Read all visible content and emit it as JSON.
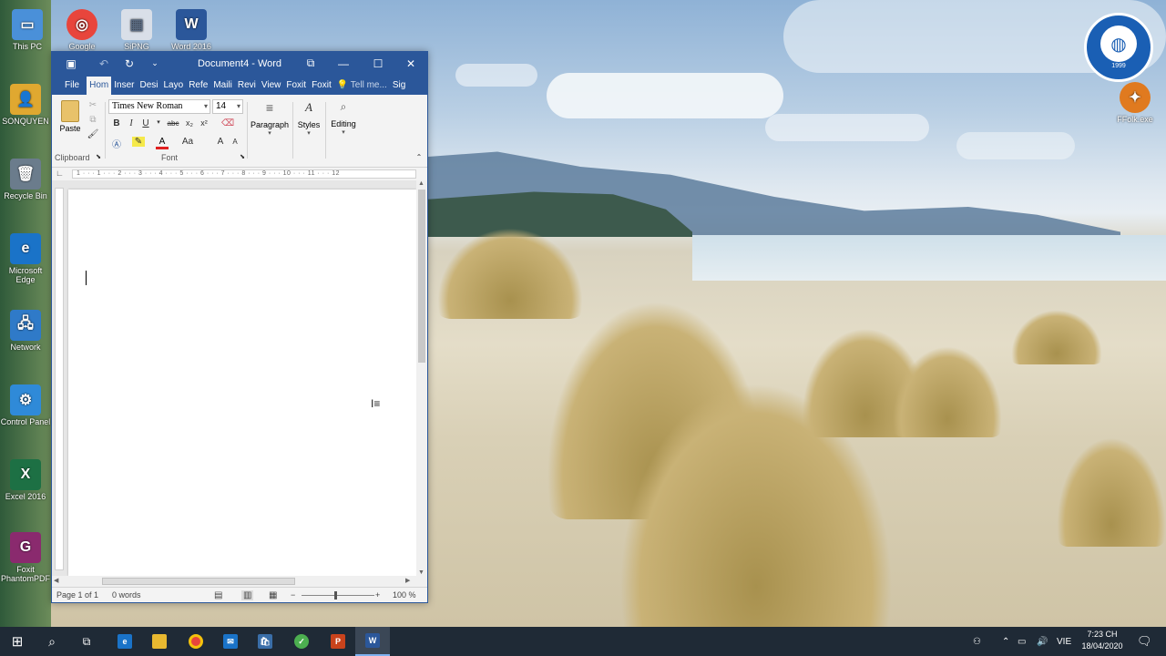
{
  "desktop": {
    "icons": [
      {
        "label": "This PC",
        "glyph": "▭",
        "color": "#4a90d9"
      },
      {
        "label": "Google",
        "glyph": "◎",
        "color": "#e8453c"
      },
      {
        "label": "SiPNG",
        "glyph": "▦",
        "color": "#d9dfe8"
      },
      {
        "label": "Word 2016",
        "glyph": "W",
        "color": "#2b579a"
      },
      {
        "label": "SONQUYEN",
        "glyph": "👤",
        "color": "#e0a830"
      },
      {
        "label": "Recycle Bin",
        "glyph": "🗑",
        "color": "#6b7c8c"
      },
      {
        "label": "Microsoft Edge",
        "glyph": "e",
        "color": "#1a73c8"
      },
      {
        "label": "Network",
        "glyph": "🖧",
        "color": "#2f7ac8"
      },
      {
        "label": "Control Panel",
        "glyph": "⚙",
        "color": "#2f8ad8"
      },
      {
        "label": "Excel 2016",
        "glyph": "X",
        "color": "#1d7044"
      },
      {
        "label": "Foxit PhantomPDF",
        "glyph": "G",
        "color": "#8a2a6e"
      },
      {
        "label": "FFolk.exe",
        "glyph": "✦",
        "color": "#e07a1f"
      }
    ],
    "logo_text": "THE ASIAN INTERNATIONAL SCHOOL",
    "logo_year": "1999"
  },
  "word": {
    "title": "Document4 - Word",
    "tabs": [
      "File",
      "Hom",
      "Inser",
      "Desi",
      "Layo",
      "Refe",
      "Maili",
      "Revi",
      "View",
      "Foxit",
      "Foxit",
      "Tell me...",
      "Sig"
    ],
    "ribbon": {
      "paste": "Paste",
      "clipboard": "Clipboard",
      "font_name": "Times New Roman",
      "font_size": "14",
      "font_group": "Font",
      "paragraph": "Paragraph",
      "styles": "Styles",
      "editing": "Editing",
      "bold": "B",
      "italic": "I",
      "underline": "U",
      "strike": "abc",
      "subscript": "x₂",
      "superscript": "x²",
      "grow": "A",
      "case": "Aa"
    },
    "ruler_text": "1 · · · 1 · · · 2 · · · 3 · · · 4 · · · 5 · · · 6 · · · 7 · · · 8 · · · 9 · · · 10 · · · 11 · · · 12",
    "status": {
      "page": "Page 1 of 1",
      "words": "0 words",
      "zoom": "100 %"
    }
  },
  "taskbar": {
    "language": "VIE",
    "time": "7:23 CH",
    "date": "18/04/2020"
  }
}
